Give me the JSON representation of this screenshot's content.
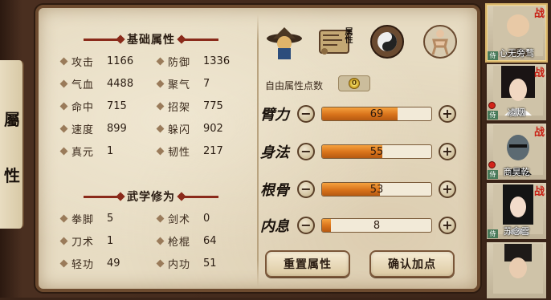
{
  "left_tab": {
    "chars": [
      "屬",
      "性"
    ]
  },
  "basic_attributes": {
    "title": "基础属性",
    "items": [
      {
        "label": "攻击",
        "value": "1166"
      },
      {
        "label": "防御",
        "value": "1336"
      },
      {
        "label": "气血",
        "value": "4488"
      },
      {
        "label": "聚气",
        "value": "7"
      },
      {
        "label": "命中",
        "value": "715"
      },
      {
        "label": "招架",
        "value": "775"
      },
      {
        "label": "速度",
        "value": "899"
      },
      {
        "label": "躲闪",
        "value": "902"
      },
      {
        "label": "真元",
        "value": "1"
      },
      {
        "label": "韧性",
        "value": "217"
      }
    ]
  },
  "martial_skills": {
    "title": "武学修为",
    "items": [
      {
        "label": "拳脚",
        "value": "5"
      },
      {
        "label": "剑术",
        "value": "0"
      },
      {
        "label": "刀术",
        "value": "1"
      },
      {
        "label": "枪棍",
        "value": "64"
      },
      {
        "label": "轻功",
        "value": "49"
      },
      {
        "label": "内功",
        "value": "51"
      }
    ]
  },
  "tab_icons": [
    {
      "name": "hat-warrior-icon"
    },
    {
      "name": "scroll-attribute-icon",
      "label": "属性"
    },
    {
      "name": "yinyang-icon"
    },
    {
      "name": "meridian-figure-icon"
    }
  ],
  "free_points": {
    "label": "自由属性点数",
    "value": "0"
  },
  "allocations": [
    {
      "name": "臂力",
      "value": "69",
      "fill": 0.69
    },
    {
      "name": "身法",
      "value": "55",
      "fill": 0.55
    },
    {
      "name": "根骨",
      "value": "53",
      "fill": 0.53
    },
    {
      "name": "内息",
      "value": "8",
      "fill": 0.08
    }
  ],
  "controls": {
    "minus": "−",
    "plus": "+"
  },
  "buttons": {
    "reset": "重置属性",
    "confirm": "确认加点"
  },
  "roster": [
    {
      "name": "心无旁骛",
      "battle": "战",
      "skin": "#e8c9a6",
      "hair": "#333"
    },
    {
      "name": "凌烟",
      "battle": "战",
      "skin": "#f1d8c2",
      "hair": "#1a1414"
    },
    {
      "name": "商昊乾",
      "battle": "战",
      "skin": "#5c6a72",
      "hair": "#2a2a2a"
    },
    {
      "name": "苏念雪",
      "battle": "战",
      "skin": "#f3dccb",
      "hair": "#141414"
    },
    {
      "name": "",
      "battle": "",
      "skin": "#e9ccb0",
      "hair": "#1e1a18"
    }
  ],
  "roster_tag": "侍"
}
